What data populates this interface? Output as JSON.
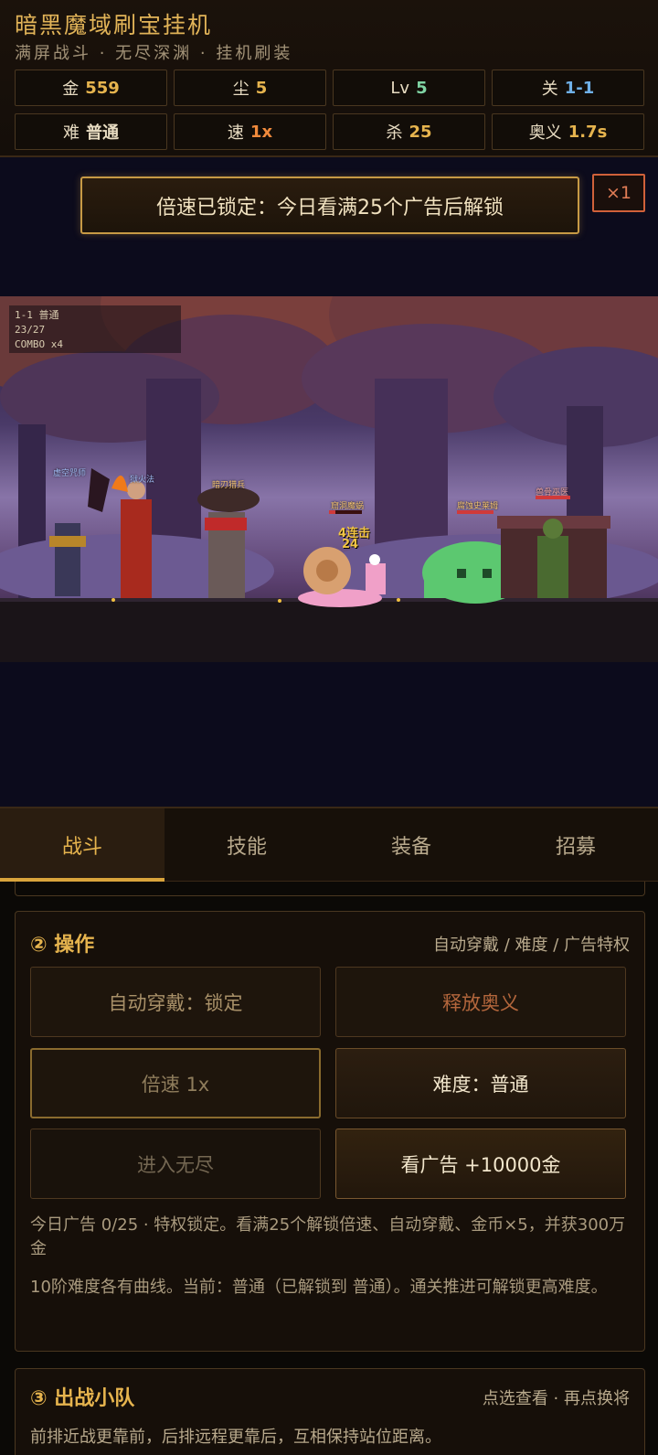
{
  "header": {
    "title": "暗黑魔域刷宝挂机",
    "subtitle": "满屏战斗 · 无尽深渊 · 挂机刷装",
    "stats": [
      {
        "label": "金",
        "value": "559",
        "color": "#e6b44e"
      },
      {
        "label": "尘",
        "value": "5",
        "color": "#e6b44e"
      },
      {
        "label": "Lv",
        "value": "5",
        "color": "#7fd3a3"
      },
      {
        "label": "关",
        "value": "1-1",
        "color": "#6fb0e8"
      },
      {
        "label": "难",
        "value": "普通",
        "color": "#f2e6cc"
      },
      {
        "label": "速",
        "value": "1x",
        "color": "#f08a3c"
      },
      {
        "label": "杀",
        "value": "25",
        "color": "#e6b44e"
      },
      {
        "label": "奥义",
        "value": "1.7s",
        "color": "#e6b44e"
      }
    ]
  },
  "battle": {
    "lock_banner": "倍速已锁定：今日看满25个广告后解锁",
    "speed_chip": "×1",
    "hud": {
      "stage_line": "1-1 普通",
      "progress": "23/27",
      "combo": "COMBO x4"
    },
    "units": {
      "hero1": "虚空咒师",
      "hero2": "狱火法",
      "hero3": "暗刃猎兵",
      "enemy1": "窟洞魔蜗",
      "enemy2": "腐蚀史莱姆",
      "enemy3": "兽骨巫医"
    },
    "combo_text": "4连击",
    "damage_text": "24"
  },
  "tabs": [
    {
      "label": "战斗",
      "active": true
    },
    {
      "label": "技能",
      "active": false
    },
    {
      "label": "装备",
      "active": false
    },
    {
      "label": "招募",
      "active": false
    }
  ],
  "operations": {
    "title": "② 操作",
    "hint": "自动穿戴 / 难度 / 广告特权",
    "auto_equip": "自动穿戴：锁定",
    "ultimate": "释放奥义",
    "speed": "倍速 1x",
    "difficulty": "难度：普通",
    "endless": "进入无尽",
    "watch_ad": "看广告 +10000金",
    "ad_note": "今日广告 0/25 · 特权锁定。看满25个解锁倍速、自动穿戴、金币×5，并获300万金",
    "difficulty_note": "10阶难度各有曲线。当前：普通（已解锁到 普通）。通关推进可解锁更高难度。"
  },
  "squad": {
    "title": "③ 出战小队",
    "hint": "点选查看 · 再点换将",
    "description": "前排近战更靠前，后排远程更靠后，互相保持站位距离。"
  }
}
